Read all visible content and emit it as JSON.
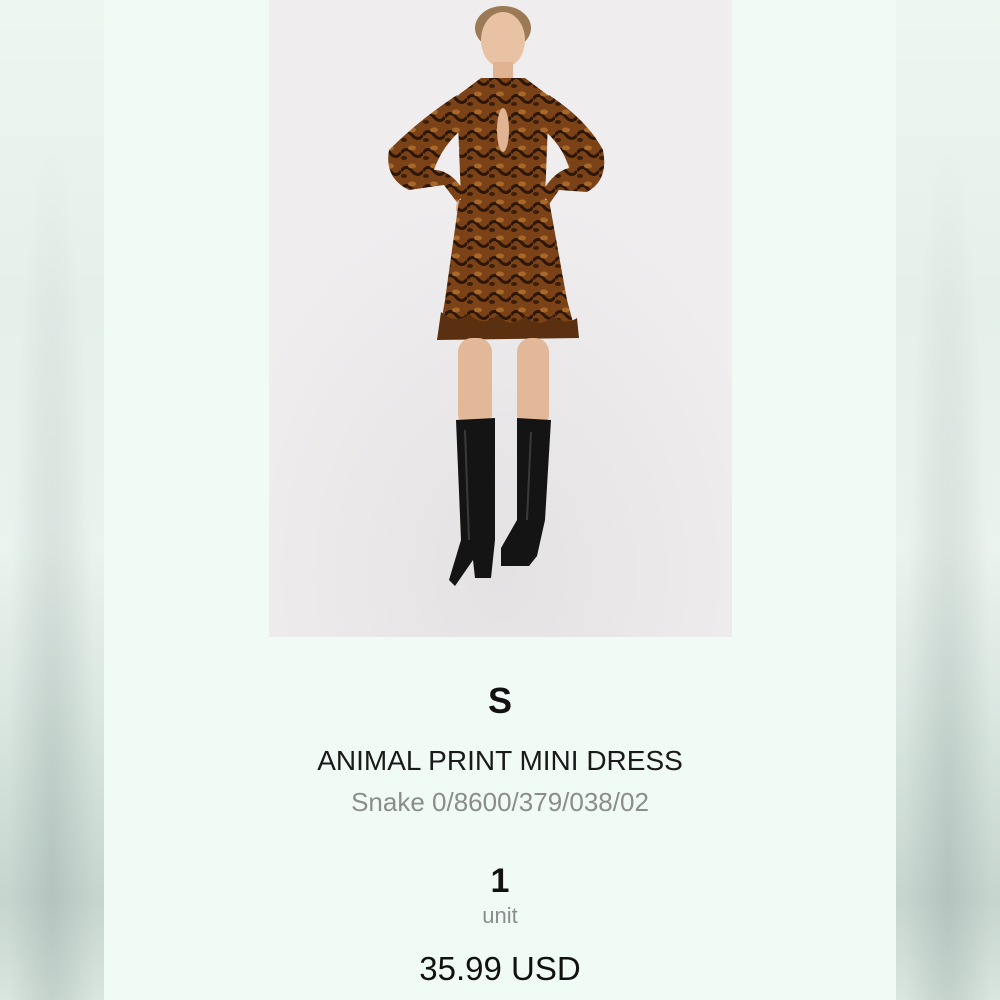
{
  "product": {
    "size": "S",
    "name": "ANIMAL PRINT MINI DRESS",
    "reference": "Snake 0/8600/379/038/02",
    "quantity": "1",
    "quantity_unit": "unit",
    "price": "35.99 USD"
  },
  "image": {
    "icon": "product-photo",
    "background_color": "#eceaeb",
    "dress_color": "#6a3a14",
    "boots_color": "#141414"
  },
  "colors": {
    "panel_background": "#f1fbf5",
    "secondary_text": "#8a8d8c",
    "primary_text": "#111111"
  }
}
